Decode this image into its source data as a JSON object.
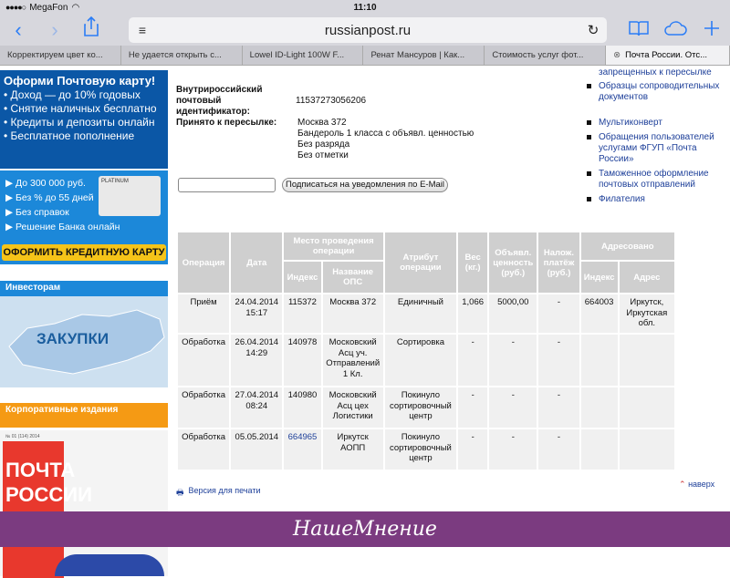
{
  "status": {
    "carrier": "MegaFon",
    "time": "11:10"
  },
  "toolbar": {
    "url": "russianpost.ru",
    "back": "‹",
    "forward": "›"
  },
  "tabs": [
    "Корректируем цвет ко...",
    "Не удается открыть с...",
    "Lowel ID-Light 100W F...",
    "Ренат Мансуров | Как...",
    "Стоимость услуг фот...",
    "Почта России. Отс..."
  ],
  "left": {
    "ad1": {
      "heading": "Оформи Почтовую карту!",
      "items": [
        "• Доход — до 10% годовых",
        "• Снятие наличных бесплатно",
        "• Кредиты и депозиты онлайн",
        "• Бесплатное пополнение"
      ]
    },
    "ad2": {
      "items": [
        "До 300 000 руб.",
        "Без % до 55 дней",
        "Без справок",
        "Решение Банка онлайн"
      ],
      "card_label": "PLATINUM",
      "button": "ОФОРМИТЬ КРЕДИТНУЮ КАРТУ"
    },
    "investors": "Инвесторам",
    "zakupki": "ЗАКУПКИ",
    "corp": "Корпоративные издания",
    "magazine": {
      "issue": "№ 01 (114) 2014",
      "logo": "ПОЧТА РОССИИ"
    }
  },
  "main": {
    "id_label": "Внутрироссийский почтовый идентификатор:",
    "id_value": "11537273056206",
    "accepted_label": "Принято к пересылке:",
    "accepted_lines": [
      "Москва 372",
      "Бандероль 1 класса с объявл. ценностью",
      "Без разряда",
      "Без отметки"
    ],
    "subscribe_button": "Подписаться на уведомления по E-Mail"
  },
  "right_links": [
    "запрещенных к пересылке",
    "Образцы сопроводительных документов",
    "Мультиконверт",
    "Обращения пользователей услугами ФГУП «Почта России»",
    "Таможенное оформление почтовых отправлений",
    "Филателия"
  ],
  "table": {
    "headers": {
      "operation": "Операция",
      "date": "Дата",
      "place": "Место проведения операции",
      "attribute": "Атрибут операции",
      "weight": "Вес (кг.)",
      "declared": "Объявл. ценность (руб.)",
      "cod": "Налож. платёж (руб.)",
      "addressed": "Адресовано",
      "index": "Индекс",
      "ops_name": "Название ОПС",
      "addr_index": "Индекс",
      "address": "Адрес"
    },
    "rows": [
      {
        "op": "Приём",
        "date": "24.04.2014 15:17",
        "index": "115372",
        "ops": "Москва 372",
        "attr": "Единичный",
        "weight": "1,066",
        "declared": "5000,00",
        "cod": "-",
        "aidx": "664003",
        "addr": "Иркутск, Иркутская обл."
      },
      {
        "op": "Обработка",
        "date": "26.04.2014 14:29",
        "index": "140978",
        "ops": "Московский Асц уч. Отправлений 1 Кл.",
        "attr": "Сортировка",
        "weight": "-",
        "declared": "-",
        "cod": "-",
        "aidx": "",
        "addr": ""
      },
      {
        "op": "Обработка",
        "date": "27.04.2014 08:24",
        "index": "140980",
        "ops": "Московский Асц цех Логистики",
        "attr": "Покинуло сортировочный центр",
        "weight": "-",
        "declared": "-",
        "cod": "-",
        "aidx": "",
        "addr": ""
      },
      {
        "op": "Обработка",
        "date": "05.05.2014",
        "index": "664965",
        "ops": "Иркутск АОПП",
        "attr": "Покинуло сортировочный центр",
        "weight": "-",
        "declared": "-",
        "cod": "-",
        "aidx": "",
        "addr": ""
      }
    ]
  },
  "print_link": "Версия для печати",
  "up_link": "наверх",
  "footer": "НашеМнение"
}
